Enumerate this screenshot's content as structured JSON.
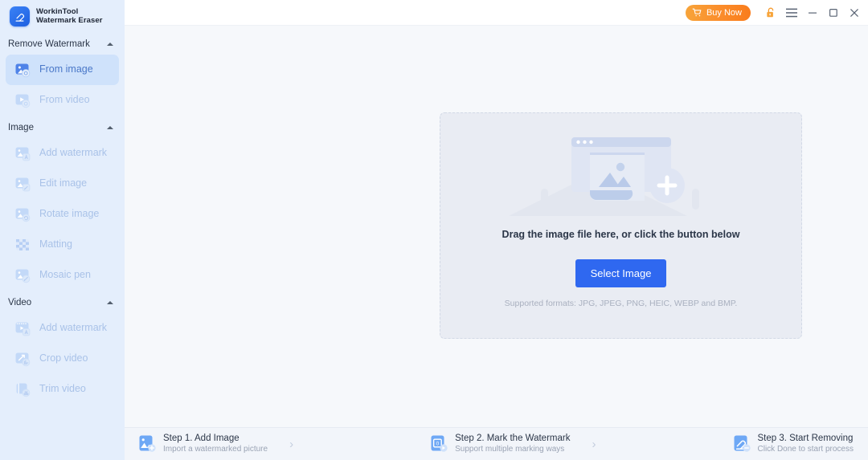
{
  "brand": {
    "logo_icon": "eraser-icon",
    "line1": "WorkinTool",
    "line2": "Watermark Eraser"
  },
  "titlebar": {
    "buy_label": "Buy Now",
    "buy_icon": "cart-icon",
    "lock_icon": "unlocked-padlock-icon",
    "menu_icon": "hamburger-menu-icon",
    "minimize_icon": "minimize-icon",
    "maximize_icon": "maximize-icon",
    "close_icon": "close-icon",
    "accent_buy": "#f9881f",
    "accent_lock": "#f79a2b"
  },
  "sidebar": {
    "background": "#e4eefc",
    "active_background": "#cfe2fb",
    "active_text": "#4a78c8",
    "inactive_text": "#a9c2e8",
    "sections": [
      {
        "title": "Remove Watermark",
        "collapsed": false,
        "items": [
          {
            "label": "From image",
            "icon": "image-watermark-icon",
            "active": true
          },
          {
            "label": "From video",
            "icon": "video-watermark-icon",
            "active": false
          }
        ]
      },
      {
        "title": "Image",
        "collapsed": false,
        "items": [
          {
            "label": "Add watermark",
            "icon": "add-watermark-image-icon",
            "active": false
          },
          {
            "label": "Edit image",
            "icon": "edit-image-icon",
            "active": false
          },
          {
            "label": "Rotate image",
            "icon": "rotate-image-icon",
            "active": false
          },
          {
            "label": "Matting",
            "icon": "matting-icon",
            "active": false
          },
          {
            "label": "Mosaic pen",
            "icon": "mosaic-pen-icon",
            "active": false
          }
        ]
      },
      {
        "title": "Video",
        "collapsed": false,
        "items": [
          {
            "label": "Add watermark",
            "icon": "add-watermark-video-icon",
            "active": false
          },
          {
            "label": "Crop video",
            "icon": "crop-video-icon",
            "active": false
          },
          {
            "label": "Trim video",
            "icon": "trim-video-icon",
            "active": false
          }
        ]
      }
    ]
  },
  "dropzone": {
    "illustration_icon": "image-placeholder-illustration",
    "drag_text": "Drag the image file here, or click the button below",
    "select_button": "Select Image",
    "select_button_color": "#2f68f0",
    "formats": "Supported formats: JPG, JPEG, PNG, HEIC, WEBP and BMP."
  },
  "steps": [
    {
      "title": "Step 1. Add Image",
      "subtitle": "Import a watermarked picture",
      "icon": "add-image-step-icon"
    },
    {
      "title": "Step 2. Mark the Watermark",
      "subtitle": "Support multiple marking ways",
      "icon": "mark-watermark-step-icon"
    },
    {
      "title": "Step 3. Start Removing",
      "subtitle": "Click Done to start process",
      "icon": "start-removing-step-icon"
    }
  ],
  "step_arrow": "›"
}
